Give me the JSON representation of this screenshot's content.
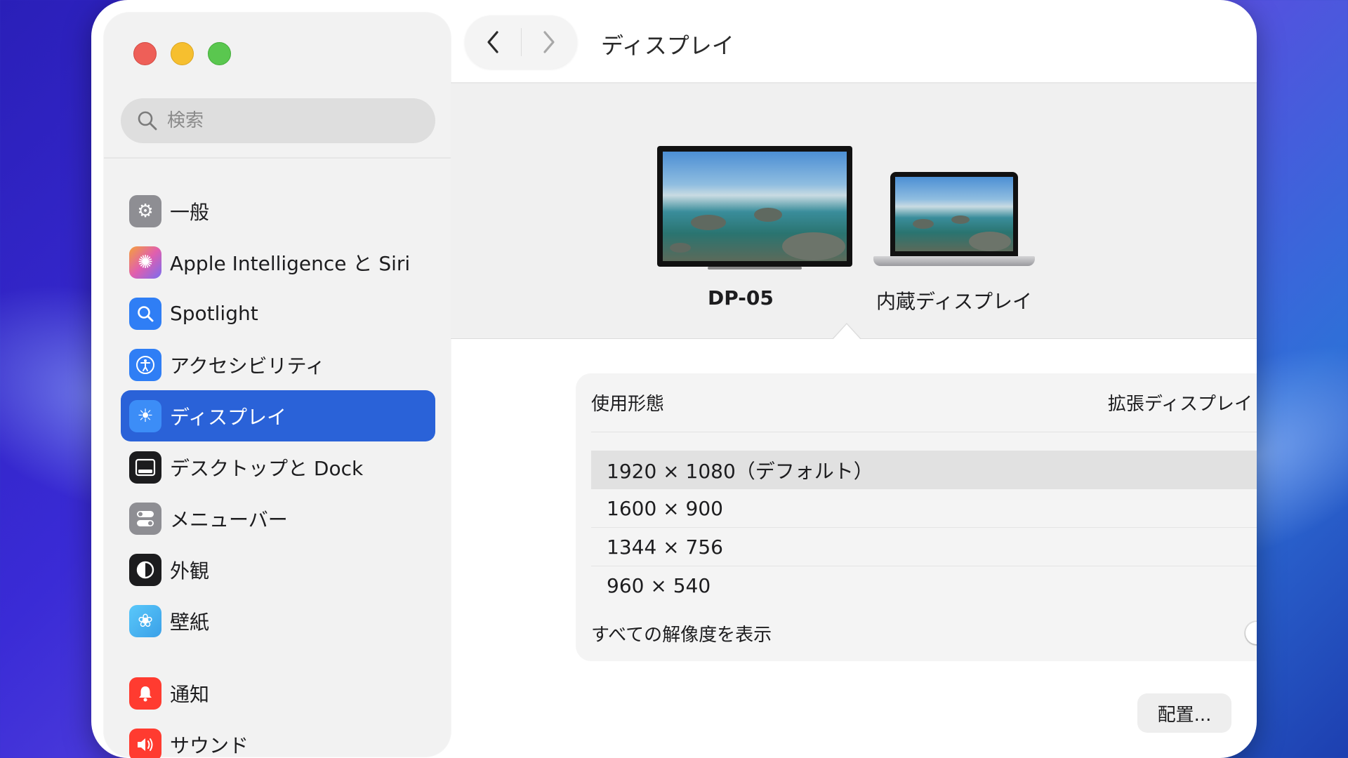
{
  "window": {
    "title": "ディスプレイ"
  },
  "search": {
    "placeholder": "検索"
  },
  "sidebar": {
    "items": [
      {
        "label": "一般",
        "icon": "gear-icon",
        "color": "#8e8e93"
      },
      {
        "label": "Apple Intelligence と Siri",
        "icon": "apple-intelligence-icon",
        "color": "#e05fae"
      },
      {
        "label": "Spotlight",
        "icon": "magnifier-icon",
        "color": "#2f7ef5"
      },
      {
        "label": "アクセシビリティ",
        "icon": "accessibility-icon",
        "color": "#2f7ef5"
      },
      {
        "label": "ディスプレイ",
        "icon": "sun-icon",
        "color": "#2f7ef5",
        "active": true
      },
      {
        "label": "デスクトップと Dock",
        "icon": "dock-icon",
        "color": "#1c1c1e"
      },
      {
        "label": "メニューバー",
        "icon": "toggle-switches-icon",
        "color": "#8e8e93"
      },
      {
        "label": "外観",
        "icon": "appearance-icon",
        "color": "#1c1c1e"
      },
      {
        "label": "壁紙",
        "icon": "flower-icon",
        "color": "#5ac8fa"
      },
      {
        "label": "通知",
        "icon": "bell-icon",
        "color": "#ff3b30"
      },
      {
        "label": "サウンド",
        "icon": "speaker-icon",
        "color": "#ff3b30"
      }
    ]
  },
  "displays": [
    {
      "label": "DP-05",
      "selected": true
    },
    {
      "label": "内蔵ディスプレイ",
      "selected": false
    }
  ],
  "settings": {
    "usage_label": "使用形態",
    "usage_value": "拡張ディスプレイ",
    "resolutions": [
      "1920 × 1080（デフォルト）",
      "1600 × 900",
      "1344 × 756",
      "960 × 540"
    ],
    "selected_resolution_index": 0,
    "show_all_label": "すべての解像度を表示",
    "show_all_enabled": false
  },
  "arrange_button": "配置..."
}
